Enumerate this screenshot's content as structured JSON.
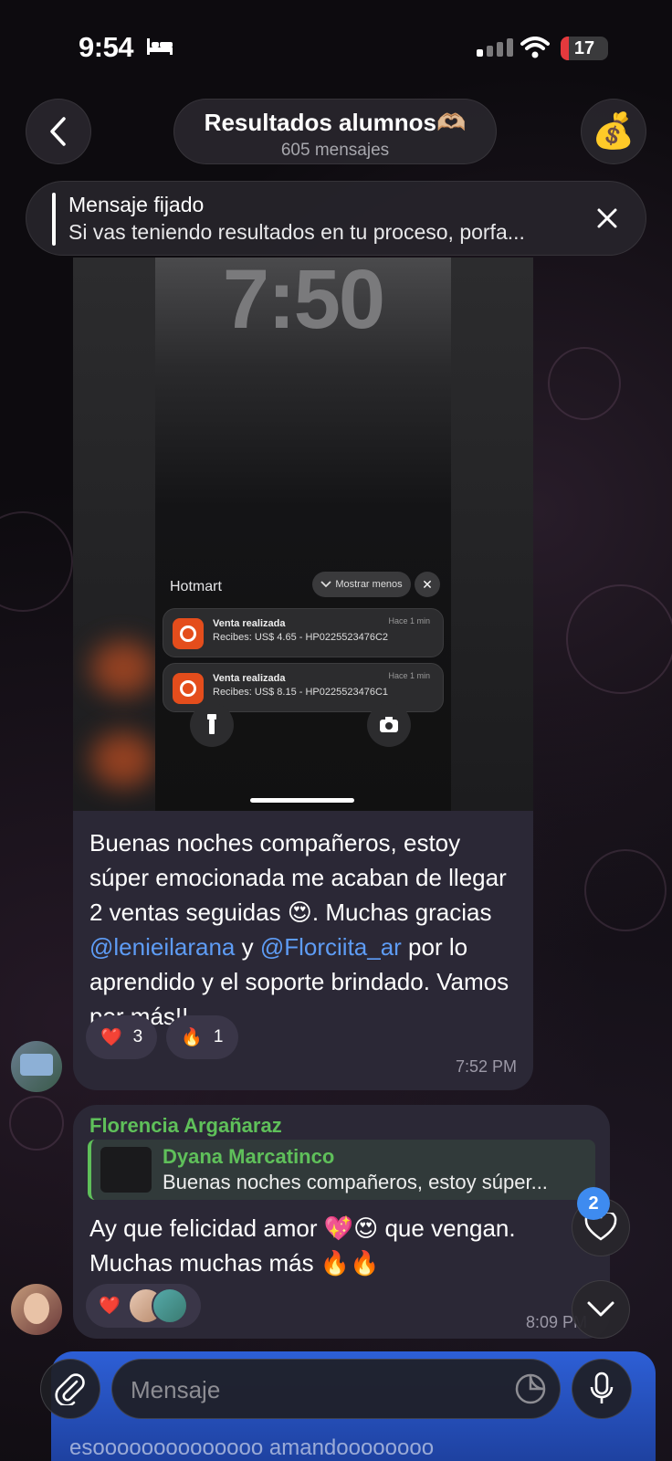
{
  "status_bar": {
    "time": "9:54",
    "battery": "17"
  },
  "header": {
    "title": "Resultados alumnos🫶🏼",
    "subtitle": "605 mensajes",
    "chat_avatar_emoji": "💰"
  },
  "pinned": {
    "label": "Mensaje fijado",
    "text": "Si vas teniendo resultados en tu proceso, porfa..."
  },
  "screenshot": {
    "clock": "7:50",
    "app": "Hotmart",
    "toggle_label": "Mostrar menos",
    "notifications": [
      {
        "title": "Venta realizada",
        "body": "Recibes: US$ 4.65 - HP0225523476C2",
        "time": "Hace 1 min"
      },
      {
        "title": "Venta realizada",
        "body": "Recibes: US$ 8.15 - HP0225523476C1",
        "time": "Hace 1 min"
      }
    ]
  },
  "message1": {
    "text_a": "Buenas noches compañeros, estoy súper emocionada me acaban de llegar 2 ventas seguidas 😍. Muchas gracias ",
    "mention1": "@lenieilarana",
    "text_b": " y ",
    "mention2": "@Florciita_ar",
    "text_c": " por lo aprendido y el soporte brindado. Vamos por más!!",
    "reactions": [
      {
        "emoji": "❤️",
        "count": "3"
      },
      {
        "emoji": "🔥",
        "count": "1"
      }
    ],
    "time": "7:52 PM"
  },
  "message2": {
    "sender": "Florencia Argañaraz",
    "reply_name": "Dyana Marcatinco",
    "reply_text": "Buenas noches compañeros, estoy súper...",
    "text": "Ay que felicidad amor 💖😍 que vengan. Muchas muchas más 🔥🔥",
    "reaction_emoji": "❤️",
    "time": "8:09 PM"
  },
  "unread_badge": "2",
  "composer": {
    "placeholder": "Mensaje",
    "background_text": "esoooooooooooooo amandoooooooo"
  },
  "colors": {
    "mention": "#5e9cf5",
    "sender": "#5fc05a",
    "bubble": "#2b2836",
    "badge": "#3e8bf0"
  }
}
